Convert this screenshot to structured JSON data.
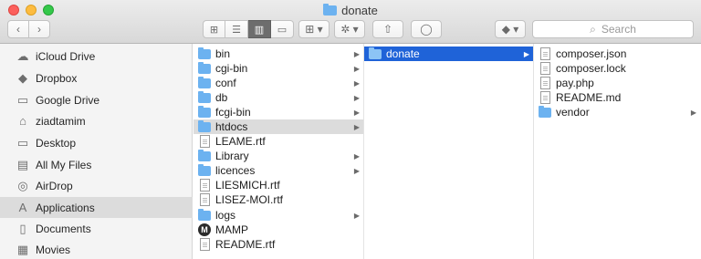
{
  "window": {
    "title": "donate"
  },
  "toolbar": {
    "back_icon": "‹",
    "forward_icon": "›",
    "view_icons": [
      "⊞",
      "☰",
      "▥",
      "▭"
    ],
    "arrange_icon": "⊞ ▾",
    "action_icon": "✲ ▾",
    "share_icon": "⇧",
    "tag_icon": "◯",
    "dropbox_icon": "◆ ▾",
    "search_placeholder": "Search",
    "search_icon": "⌕"
  },
  "sidebar": {
    "items": [
      {
        "label": "iCloud Drive",
        "icon": "☁"
      },
      {
        "label": "Dropbox",
        "icon": "◆"
      },
      {
        "label": "Google Drive",
        "icon": "▭"
      },
      {
        "label": "ziadtamim",
        "icon": "⌂"
      },
      {
        "label": "Desktop",
        "icon": "▭"
      },
      {
        "label": "All My Files",
        "icon": "▤"
      },
      {
        "label": "AirDrop",
        "icon": "◎"
      },
      {
        "label": "Applications",
        "icon": "A"
      },
      {
        "label": "Documents",
        "icon": "▯"
      },
      {
        "label": "Movies",
        "icon": "▦"
      }
    ]
  },
  "columns": {
    "col1": [
      {
        "name": "bin",
        "type": "folder",
        "chevron": "▶"
      },
      {
        "name": "cgi-bin",
        "type": "folder",
        "chevron": "▶"
      },
      {
        "name": "conf",
        "type": "folder",
        "chevron": "▶"
      },
      {
        "name": "db",
        "type": "folder",
        "chevron": "▶"
      },
      {
        "name": "fcgi-bin",
        "type": "folder",
        "chevron": "▶"
      },
      {
        "name": "htdocs",
        "type": "folder",
        "chevron": "▶"
      },
      {
        "name": "LEAME.rtf",
        "type": "file",
        "chevron": ""
      },
      {
        "name": "Library",
        "type": "folder",
        "chevron": "▶"
      },
      {
        "name": "licences",
        "type": "folder",
        "chevron": "▶"
      },
      {
        "name": "LIESMICH.rtf",
        "type": "file",
        "chevron": ""
      },
      {
        "name": "LISEZ-MOI.rtf",
        "type": "file",
        "chevron": ""
      },
      {
        "name": "logs",
        "type": "folder",
        "chevron": "▶"
      },
      {
        "name": "MAMP",
        "type": "app",
        "chevron": ""
      },
      {
        "name": "README.rtf",
        "type": "file",
        "chevron": ""
      }
    ],
    "col2": [
      {
        "name": "donate",
        "type": "folder",
        "chevron": "▶"
      }
    ],
    "col3": [
      {
        "name": "composer.json",
        "type": "file",
        "chevron": ""
      },
      {
        "name": "composer.lock",
        "type": "file",
        "chevron": ""
      },
      {
        "name": "pay.php",
        "type": "file",
        "chevron": ""
      },
      {
        "name": "README.md",
        "type": "file",
        "chevron": ""
      },
      {
        "name": "vendor",
        "type": "folder",
        "chevron": "▶"
      }
    ]
  }
}
